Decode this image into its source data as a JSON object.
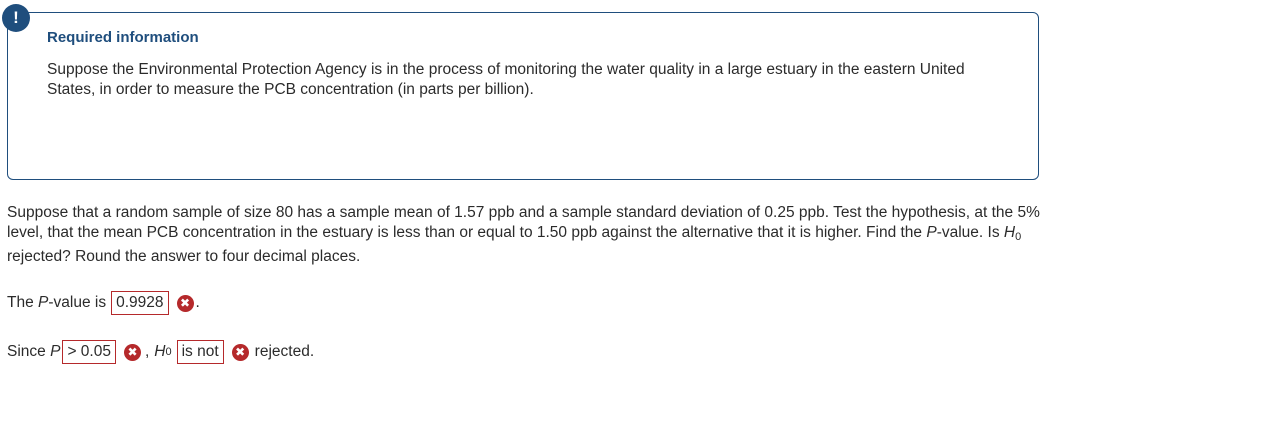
{
  "alert": {
    "symbol": "!"
  },
  "info": {
    "title": "Required information",
    "text": "Suppose the Environmental Protection Agency is in the process of monitoring the water quality in a large estuary in the eastern United States, in order to measure the PCB concentration (in parts per billion)."
  },
  "question": {
    "part1": "Suppose that a random sample of size 80 has a sample mean of 1.57 ppb and a sample standard deviation of 0.25 ppb. Test the hypothesis, at the 5% level, that the mean PCB concentration in the estuary is less than or equal to 1.50 ppb against the alternative that it is higher. Find the ",
    "p_italic": "P",
    "part2": "-value. Is ",
    "h_italic": "H",
    "h_sub": "0",
    "part3": " rejected? Round the answer to four decimal places."
  },
  "answer1": {
    "prefix": "The ",
    "p_italic": "P",
    "middle": "-value is",
    "value": "0.9928",
    "suffix": "."
  },
  "answer2": {
    "prefix": "Since ",
    "p_italic": "P",
    "comparison": "> 0.05",
    "comma": ",",
    "h_italic": "H",
    "h_sub": "0",
    "decision": "is not",
    "suffix": "rejected."
  },
  "icons": {
    "incorrect": "✖"
  },
  "colors": {
    "accent": "#1f4e7d",
    "error": "#b5292b",
    "text": "#2b2b2b"
  }
}
